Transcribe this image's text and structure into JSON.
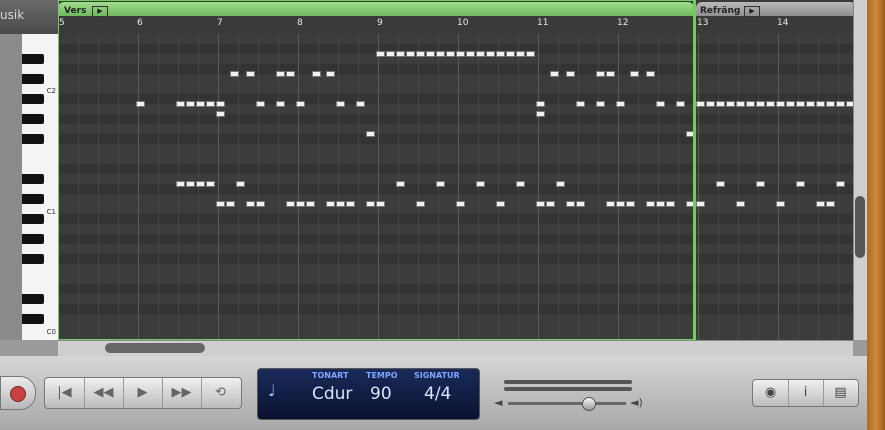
{
  "app": {
    "title_fragment": "usik"
  },
  "ruler": {
    "regions": [
      {
        "name": "Vers"
      },
      {
        "name": "Refräng"
      }
    ],
    "bar_numbers": [
      "5",
      "6",
      "7",
      "8",
      "9",
      "10",
      "11",
      "12",
      "13",
      "14"
    ]
  },
  "keyboard": {
    "octave_labels": [
      "C2",
      "C1",
      "C0"
    ]
  },
  "piano_roll": {
    "notes_note": "note rows expressed as pitch-lane index",
    "lanes_visible": 30
  },
  "transport": {
    "buttons": [
      {
        "name": "go-to-start",
        "glyph": "|◀"
      },
      {
        "name": "rewind",
        "glyph": "◀◀"
      },
      {
        "name": "play",
        "glyph": "▶"
      },
      {
        "name": "fast-forward",
        "glyph": "▶▶"
      },
      {
        "name": "cycle",
        "glyph": "⟲"
      }
    ]
  },
  "lcd": {
    "tonart_label": "TONART",
    "tonart_value": "Cdur",
    "tempo_label": "TEMPO",
    "tempo_value": "90",
    "signatur_label": "SIGNATUR",
    "signatur_value": "4/4"
  },
  "volume": {
    "level": 0.63
  },
  "right_buttons": [
    {
      "name": "view",
      "glyph": "◉"
    },
    {
      "name": "info",
      "glyph": "i"
    },
    {
      "name": "media",
      "glyph": "▤"
    }
  ]
}
